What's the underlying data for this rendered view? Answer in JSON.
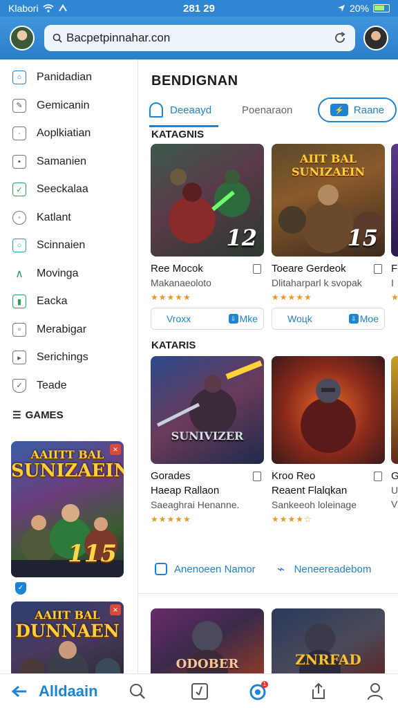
{
  "status_bar": {
    "carrier": "Klabori",
    "time": "281 29",
    "battery": "20%"
  },
  "app_bar": {
    "url_value": "Bacpetpinnahar.con"
  },
  "sidebar": {
    "items": [
      {
        "label": "Panidadian",
        "icon": "circle-icon"
      },
      {
        "label": "Gemicanin",
        "icon": "edit-icon"
      },
      {
        "label": "Aoplkiatian",
        "icon": "square-dot-icon"
      },
      {
        "label": "Samanien",
        "icon": "image-icon"
      },
      {
        "label": "Seeckalaa",
        "icon": "leaf-icon"
      },
      {
        "label": "Katlant",
        "icon": "user-icon"
      },
      {
        "label": "Scinnaien",
        "icon": "app-icon"
      },
      {
        "label": "Movinga",
        "icon": "android-icon"
      },
      {
        "label": "Eacka",
        "icon": "book-icon"
      },
      {
        "label": "Merabigar",
        "icon": "calendar-icon"
      },
      {
        "label": "Serichings",
        "icon": "settings-box-icon"
      },
      {
        "label": "Teade",
        "icon": "shield-icon"
      }
    ],
    "section_label": "GAMES",
    "promos": [
      {
        "title_line1": "AAIITT BAL",
        "title_line2": "SUNIZAEIN",
        "number": "115"
      },
      {
        "title_line1": "AAIIT BAL",
        "title_line2": "DUNNAEN",
        "number": ""
      }
    ]
  },
  "main": {
    "page_title": "BENDIGNAN",
    "tabs": [
      {
        "label": "Deeaayd"
      },
      {
        "label": "Poenaraon"
      }
    ],
    "pill": {
      "label": "Raane",
      "icon_text": "⚡"
    },
    "section1_label": "KATAGNIS",
    "section2_label": "KATARIS",
    "row1": [
      {
        "name": "Ree Mocok",
        "sub": "Makanaeoloto",
        "stars": "★★★★★",
        "number": "12",
        "art_title": "",
        "action_left": "Vroxx",
        "action_right": "Mke"
      },
      {
        "name": "Toeare Gerdeok",
        "sub": "Dlitaharparl k svopak",
        "stars": "★★★★★",
        "number": "15",
        "art_title": "AIIT BAL SUNIZAEIN",
        "action_left": "Woцk",
        "action_right": "Moe"
      },
      {
        "name": "F",
        "sub": "I",
        "stars": "★",
        "number": "",
        "art_title": "",
        "action_left": "",
        "action_right": ""
      }
    ],
    "row2": [
      {
        "name": "Gorades",
        "sub2": "Haeap Rallaon",
        "sub": "Saeaghrai Henanne.",
        "stars": "★★★★★",
        "art_title": "SUNIVIZER"
      },
      {
        "name": "Kroo Reo",
        "sub2": "Reaent Flalqkan",
        "sub": "Sankeeoh loleinage",
        "stars": "★★★★☆",
        "art_title": ""
      },
      {
        "name": "G",
        "sub2": "U",
        "sub": "V",
        "stars": "★",
        "art_title": ""
      }
    ],
    "links": [
      {
        "label": "Anenoeen Namor"
      },
      {
        "label": "Neneereadebom"
      }
    ],
    "row3": [
      {
        "art_title": "ODOBER"
      },
      {
        "art_title": "ZNRFAD"
      }
    ]
  },
  "bottom_nav": {
    "brand": "Alldaain",
    "notification_dot": "1"
  },
  "colors": {
    "accent": "#1d84d4",
    "app_bar": "#2f86d2",
    "stars": "#e89a22"
  }
}
